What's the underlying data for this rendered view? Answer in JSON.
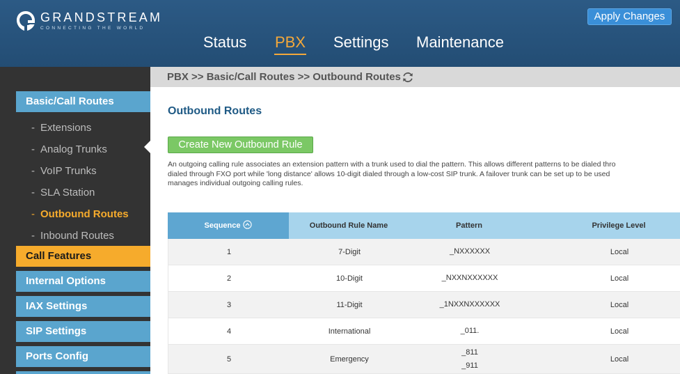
{
  "header": {
    "logo_name": "GRANDSTREAM",
    "logo_tagline": "CONNECTING THE WORLD",
    "apply_label": "Apply Changes",
    "nav": [
      {
        "label": "Status",
        "active": false
      },
      {
        "label": "PBX",
        "active": true
      },
      {
        "label": "Settings",
        "active": false
      },
      {
        "label": "Maintenance",
        "active": false
      }
    ]
  },
  "sidebar": {
    "sections": [
      {
        "label": "Basic/Call Routes"
      },
      {
        "label": "Call Features"
      },
      {
        "label": "Internal Options"
      },
      {
        "label": "IAX Settings"
      },
      {
        "label": "SIP Settings"
      },
      {
        "label": "Ports Config"
      }
    ],
    "subitems": [
      {
        "label": "Extensions"
      },
      {
        "label": "Analog Trunks"
      },
      {
        "label": "VoIP Trunks"
      },
      {
        "label": "SLA Station"
      },
      {
        "label": "Outbound Routes",
        "active": true
      },
      {
        "label": "Inbound Routes"
      }
    ],
    "dash": "-"
  },
  "breadcrumb": "PBX >> Basic/Call Routes >> Outbound Routes",
  "page_title": "Outbound Routes",
  "create_label": "Create New Outbound Rule",
  "description": {
    "line1": "An outgoing calling rule associates an extension pattern with a trunk used to dial the pattern. This allows different patterns to be dialed thro",
    "line2": "dialed through FXO port while 'long distance' allows 10-digit dialed through a low-cost SIP trunk. A failover trunk can be set up to be used",
    "line3": "manages individual outgoing calling rules."
  },
  "table": {
    "headers": [
      "Sequence",
      "Outbound Rule Name",
      "Pattern",
      "Privilege Level"
    ],
    "rows": [
      {
        "sequence": "1",
        "name": "7-Digit",
        "pattern": [
          "_NXXXXXX"
        ],
        "privilege": "Local"
      },
      {
        "sequence": "2",
        "name": "10-Digit",
        "pattern": [
          "_NXXNXXXXXX"
        ],
        "privilege": "Local"
      },
      {
        "sequence": "3",
        "name": "11-Digit",
        "pattern": [
          "_1NXXNXXXXXX"
        ],
        "privilege": "Local"
      },
      {
        "sequence": "4",
        "name": "International",
        "pattern": [
          "_011."
        ],
        "privilege": "Local"
      },
      {
        "sequence": "5",
        "name": "Emergency",
        "pattern": [
          "_811",
          "_911"
        ],
        "privilege": "Local"
      }
    ]
  },
  "colors": {
    "header_bg": "#2c5a85",
    "accent_orange": "#f6ab2c",
    "sidebar_section": "#5aa5ce",
    "create_green": "#7bc865",
    "apply_blue": "#3a8fd8"
  }
}
